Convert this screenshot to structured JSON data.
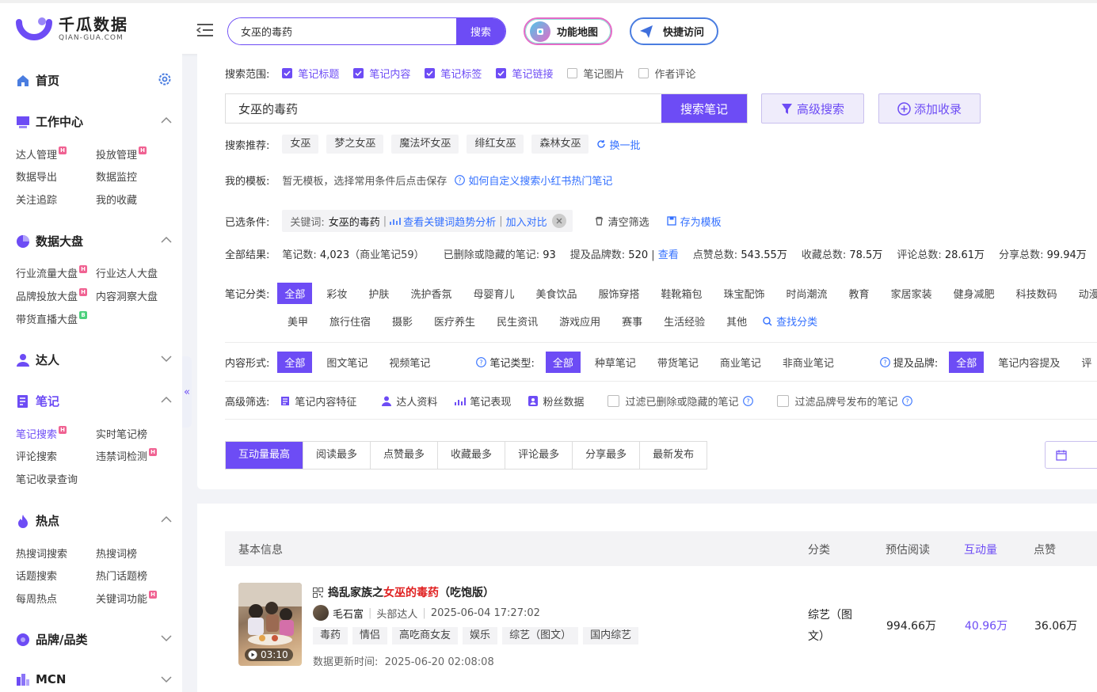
{
  "header": {
    "logo_cn": "千瓜数据",
    "logo_en": "QIAN-GUA.COM",
    "search_value": "女巫的毒药",
    "search_button": "搜索",
    "feature_map": "功能地图",
    "quick_access": "快捷访问"
  },
  "sidebar": {
    "home": "首页",
    "sections": [
      {
        "title": "工作中心",
        "items": [
          "达人管理",
          "投放管理",
          "数据导出",
          "数据监控",
          "关注追踪",
          "我的收藏"
        ]
      },
      {
        "title": "数据大盘",
        "items": [
          "行业流量大盘",
          "行业达人大盘",
          "品牌投放大盘",
          "内容洞察大盘",
          "带货直播大盘"
        ]
      },
      {
        "title": "达人"
      },
      {
        "title": "笔记",
        "items": [
          "笔记搜索",
          "实时笔记榜",
          "评论搜索",
          "违禁词检测",
          "笔记收录查询"
        ]
      },
      {
        "title": "热点",
        "items": [
          "热搜词搜索",
          "热搜词榜",
          "话题搜索",
          "热门话题榜",
          "每周热点",
          "关键词功能"
        ]
      },
      {
        "title": "品牌/品类"
      },
      {
        "title": "MCN"
      }
    ],
    "badge_h": "H",
    "badge_b": "B"
  },
  "search": {
    "scope_label": "搜索范围:",
    "scopes": [
      {
        "label": "笔记标题",
        "checked": true
      },
      {
        "label": "笔记内容",
        "checked": true
      },
      {
        "label": "笔记标签",
        "checked": true
      },
      {
        "label": "笔记链接",
        "checked": true
      },
      {
        "label": "笔记图片",
        "checked": false
      },
      {
        "label": "作者评论",
        "checked": false
      }
    ],
    "query": "女巫的毒药",
    "search_button": "搜索笔记",
    "advanced_button": "高级搜索",
    "add_button": "添加收录",
    "recommend_label": "搜索推荐:",
    "recommends": [
      "女巫",
      "梦之女巫",
      "魔法坏女巫",
      "绯红女巫",
      "森林女巫"
    ],
    "refresh": "换一批",
    "template_label": "我的模板:",
    "template_text": "暂无模板，选择常用条件后点击保存",
    "template_help": "如何自定义搜索小红书热门笔记",
    "selected_label": "已选条件:",
    "chip_key": "关键词:",
    "chip_value": "女巫的毒药",
    "chip_trend": "查看关键词趋势分析",
    "chip_compare": "加入对比",
    "clear": "清空筛选",
    "save_template": "存为模板"
  },
  "results": {
    "label": "全部结果:",
    "notes_label": "笔记数:",
    "notes": "4,023",
    "commercial": "（商业笔记59）",
    "deleted_label": "已删除或隐藏的笔记:",
    "deleted": "93",
    "brands_label": "提及品牌数:",
    "brands": "520",
    "view": "查看",
    "likes_label": "点赞总数:",
    "likes": "543.55万",
    "collects_label": "收藏总数:",
    "collects": "78.5万",
    "comments_label": "评论总数:",
    "comments": "28.61万",
    "shares_label": "分享总数:",
    "shares": "99.94万"
  },
  "category": {
    "label": "笔记分类:",
    "row1": [
      "全部",
      "彩妆",
      "护肤",
      "洗护香氛",
      "母婴育儿",
      "美食饮品",
      "服饰穿搭",
      "鞋靴箱包",
      "珠宝配饰",
      "时尚潮流",
      "教育",
      "家居家装",
      "健身减肥",
      "科技数码",
      "动漫"
    ],
    "row2": [
      "美甲",
      "旅行住宿",
      "摄影",
      "医疗养生",
      "民生资讯",
      "游戏应用",
      "赛事",
      "生活经验",
      "其他"
    ],
    "find": "查找分类"
  },
  "format": {
    "label": "内容形式:",
    "options": [
      "全部",
      "图文笔记",
      "视频笔记"
    ],
    "type_label": "笔记类型:",
    "types": [
      "全部",
      "种草笔记",
      "带货笔记",
      "商业笔记",
      "非商业笔记"
    ],
    "brand_label": "提及品牌:",
    "brands": [
      "全部",
      "笔记内容提及",
      "评"
    ]
  },
  "advanced": {
    "label": "高级筛选:",
    "items": [
      "笔记内容特征",
      "达人资料",
      "笔记表现",
      "粉丝数据"
    ],
    "filter1": "过滤已删除或隐藏的笔记",
    "filter2": "过滤品牌号发布的笔记"
  },
  "sort": [
    "互动量最高",
    "阅读最多",
    "点赞最多",
    "收藏最多",
    "评论最多",
    "分享最多",
    "最新发布"
  ],
  "table": {
    "headers": [
      "基本信息",
      "分类",
      "预估阅读",
      "互动量",
      "点赞"
    ],
    "rows": [
      {
        "title_pre": "捣乱家族之",
        "title_hl": "女巫的毒药",
        "title_post": "（吃饱版）",
        "duration": "03:10",
        "author": "毛石富",
        "author_level": "头部达人",
        "published": "2025-06-04 17:27:02",
        "tags": [
          "毒药",
          "情侣",
          "高吃商女友",
          "娱乐",
          "综艺（图文）",
          "国内综艺"
        ],
        "updated_label": "数据更新时间:",
        "updated": "2025-06-20 02:08:08",
        "category": "综艺（图文）",
        "reads": "994.66万",
        "interactions": "40.96万",
        "likes": "36.06万"
      }
    ]
  },
  "colors": {
    "accent": "#6d4cf5",
    "highlight": "#e02020",
    "link": "#3370ff"
  }
}
